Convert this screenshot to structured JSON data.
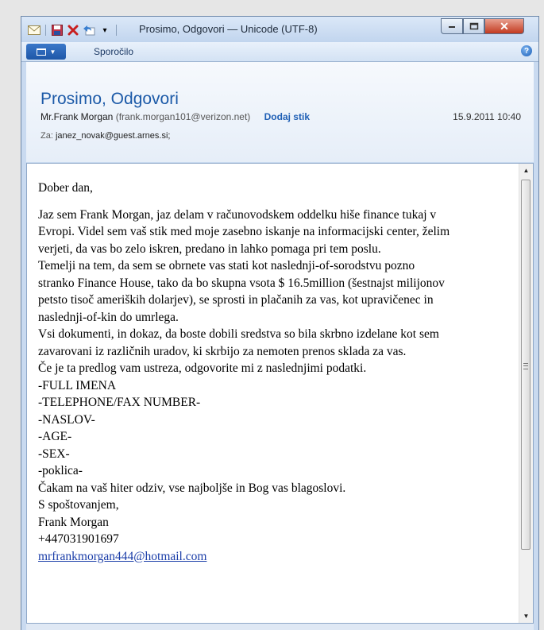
{
  "window": {
    "title": "Prosimo, Odgovori — Unicode (UTF-8)",
    "tab_message": "Sporočilo",
    "icons": [
      "envelope-icon",
      "save-icon",
      "delete-icon",
      "reply-icon",
      "customize-icon"
    ]
  },
  "header": {
    "subject": "Prosimo, Odgovori",
    "sender_name": "Mr.Frank Morgan",
    "sender_email": "(frank.morgan101@verizon.net)",
    "add_contact": "Dodaj stik",
    "date": "15.9.2011 10:40",
    "to_label": "Za:",
    "to_value": "janez_novak@guest.arnes.si;"
  },
  "body": {
    "greeting": "Dober dan,",
    "lines": [
      "Jaz sem Frank Morgan, jaz delam v računovodskem oddelku hiše finance tukaj v",
      "Evropi. Videl sem vaš stik med moje zasebno iskanje na informacijski center, želim",
      "verjeti, da vas bo zelo iskren, predano in lahko pomaga pri tem poslu.",
      "Temelji na tem, da sem se obrnete vas stati kot naslednji-of-sorodstvu pozno",
      "stranko Finance House, tako da bo skupna vsota $ 16.5million (šestnajst milijonov",
      "petsto tisoč ameriških dolarjev), se sprosti in plačanih za vas, kot upravičenec in",
      "naslednji-of-kin do umrlega.",
      "Vsi dokumenti, in dokaz, da boste dobili sredstva so bila skrbno izdelane kot sem",
      "zavarovani iz različnih uradov, ki skrbijo za nemoten prenos sklada za vas.",
      "Če je ta predlog vam ustreza, odgovorite mi z naslednjimi podatki.",
      "-FULL IMENA",
      "-TELEPHONE/FAX NUMBER-",
      "-NASLOV-",
      "-AGE-",
      "-SEX-",
      "-poklica-",
      "Čakam na vaš hiter odziv, vse najboljše in Bog vas blagoslovi.",
      "S spoštovanjem,",
      "Frank Morgan",
      "+447031901697"
    ],
    "email_link": "mrfrankmorgan444@hotmail.com"
  }
}
